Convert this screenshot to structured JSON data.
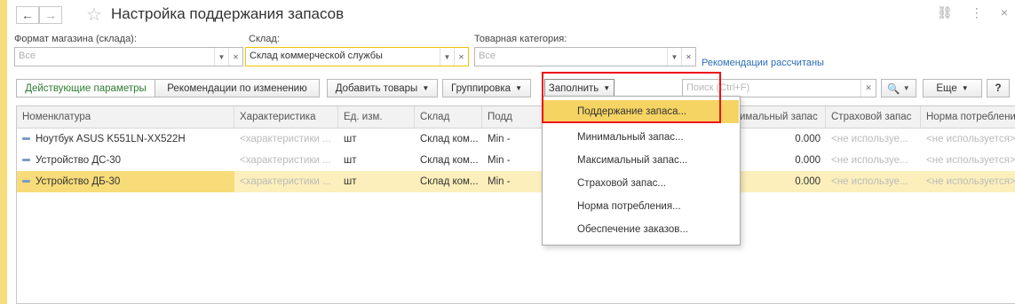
{
  "window": {
    "title": "Настройка поддержания запасов"
  },
  "filters": {
    "store_format": {
      "label": "Формат магазина (склада):",
      "placeholder": "Все"
    },
    "warehouse": {
      "label": "Склад:",
      "value": "Склад коммерческой службы"
    },
    "category": {
      "label": "Товарная категория:",
      "placeholder": "Все"
    },
    "recommendations_link": "Рекомендации рассчитаны"
  },
  "toolbar": {
    "current_params": "Действующие параметры",
    "change_recommendations": "Рекомендации по изменению",
    "add_goods": "Добавить товары",
    "grouping": "Группировка",
    "fill": "Заполнить",
    "search_placeholder": "Поиск (Ctrl+F)",
    "more": "Еще",
    "help": "?"
  },
  "table": {
    "columns": [
      "Номенклатура",
      "Характеристика",
      "Ед. изм.",
      "Склад",
      "Подд",
      "имальный запас",
      "Страховой запас",
      "Норма потребления"
    ],
    "rows": [
      [
        "Ноутбук ASUS K551LN-XX522H",
        "<характеристики ...",
        "шт",
        "Склад ком...",
        "Min - ",
        "0.000",
        "<не используе...",
        "<не используется>"
      ],
      [
        "Устройство ДС-30",
        "<характеристики ...",
        "шт",
        "Склад ком...",
        "Min - ",
        "0.000",
        "<не используе...",
        "<не используется>"
      ],
      [
        "Устройство ДБ-30",
        "<характеристики ...",
        "шт",
        "Склад ком...",
        "Min - ",
        "0.000",
        "<не используе...",
        "<не используется>"
      ]
    ],
    "selected_row": 2
  },
  "fill_menu": {
    "items": [
      "Поддержание запаса...",
      "Минимальный запас...",
      "Максимальный запас...",
      "Страховой запас...",
      "Норма потребления...",
      "Обеспечение заказов..."
    ],
    "highlighted": 0
  },
  "colors": {
    "accent_yellow": "#f6d463",
    "selection": "#fcefbb",
    "highlight_box": "#e11111",
    "link": "#2a6db6"
  }
}
